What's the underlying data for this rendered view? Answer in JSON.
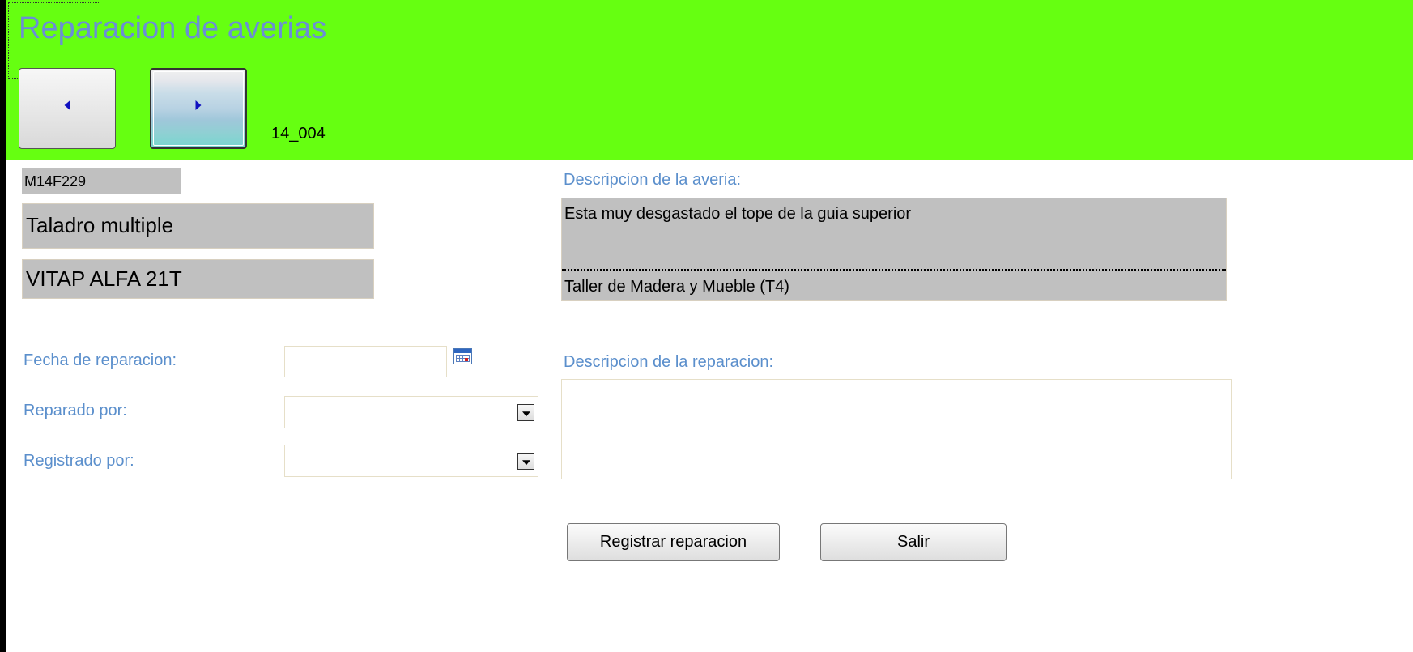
{
  "header": {
    "title": "Reparacion de averias",
    "prev_icon": "arrow-left-icon",
    "next_icon": "arrow-right-icon",
    "record_id": "14_004",
    "background_color": "#66ff11"
  },
  "machine": {
    "code": "M14F229",
    "name": "Taladro multiple",
    "model": "VITAP ALFA 21T"
  },
  "fault": {
    "label": "Descripcion de la averia:",
    "description": "Esta muy desgastado el tope de la guia superior",
    "workshop": "Taller de Madera y Mueble (T4)"
  },
  "form": {
    "date_label": "Fecha de reparacion:",
    "date_value": "",
    "calendar_icon": "calendar-icon",
    "repaired_by_label": "Reparado por:",
    "repaired_by_value": "",
    "registered_by_label": "Registrado por:",
    "registered_by_value": "",
    "repair_desc_label": "Descripcion de la reparacion:",
    "repair_desc_value": ""
  },
  "buttons": {
    "register": "Registrar reparacion",
    "exit": "Salir"
  },
  "colors": {
    "label": "#5b8fcc",
    "readonly_field": "#c0c0c0"
  }
}
